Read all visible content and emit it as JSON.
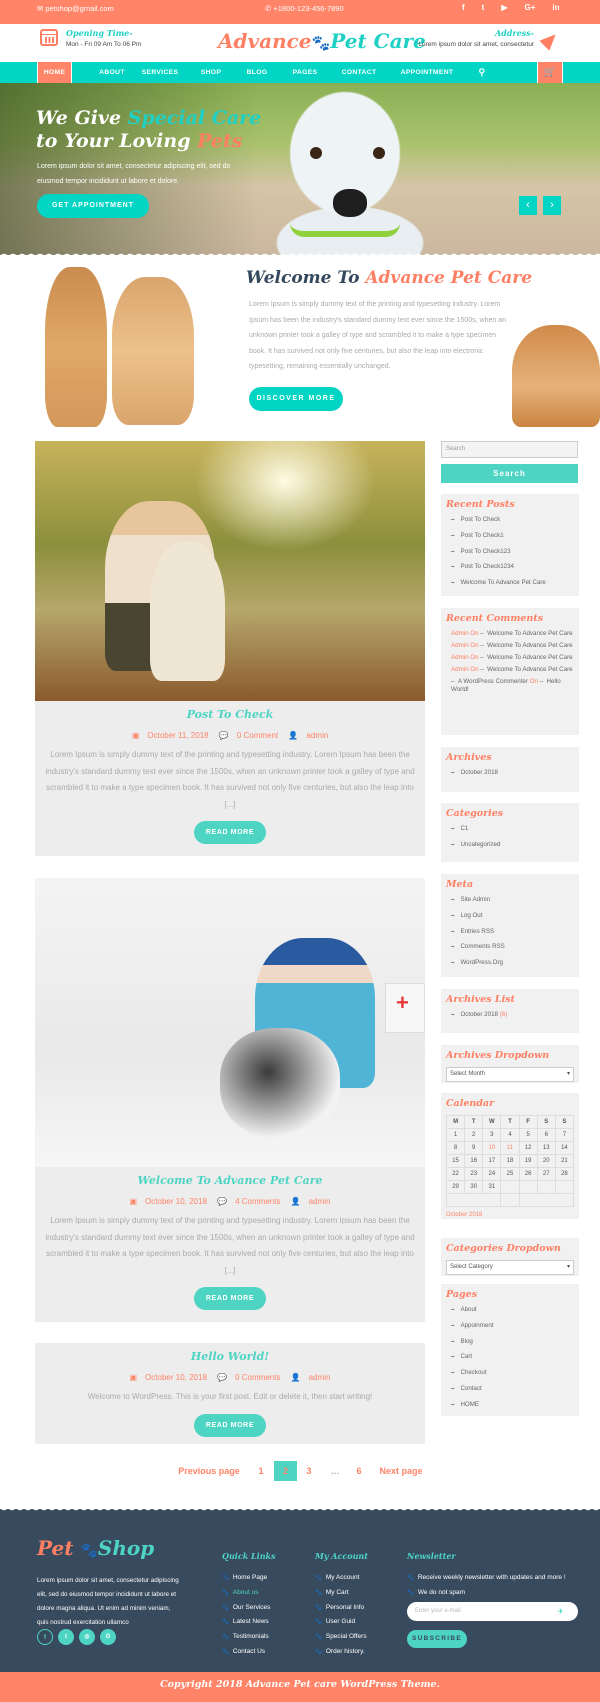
{
  "topbar": {
    "email": "petshop@gmail.com",
    "phone": "+1800-123-456-7890",
    "social": [
      "f",
      "t",
      "▶",
      "G+",
      "in"
    ],
    "social_names": [
      "facebook",
      "twitter",
      "youtube",
      "google-plus",
      "linkedin"
    ]
  },
  "header": {
    "opening_title": "Opening Time-",
    "opening_hours": "Mon - Fri 09 Am To 06 Pm",
    "logo_part1": "Advance",
    "logo_paw": "🐾",
    "logo_part2": "Pet Care",
    "address_title": "Address-",
    "address_text": "Lorem ipsum dolor sit amet, consectetur"
  },
  "nav": {
    "items": [
      "HOME",
      "ABOUT",
      "SERVICES",
      "SHOP",
      "BLOG",
      "PAGES",
      "CONTACT",
      "APPOINTMENT"
    ],
    "search_icon": "⚲",
    "cart_icon": "🛒"
  },
  "hero": {
    "line1_a": "We Give ",
    "line1_b": "Special Care",
    "line2_a": "to Your Loving ",
    "line2_b": "Pets",
    "text": "Lorem ipsum dolor sit amet, consectetur adipiscing elit, sed do eiusmod tempor incididunt ut labore et dolore.",
    "button": "GET APPOINTMENT",
    "prev": "‹",
    "next": "›"
  },
  "welcome": {
    "title_a": "Welcome To ",
    "title_b": "Advance Pet Care",
    "text": "Lorem Ipsum is simply dummy text of the printing and typesetting industry. Lorem Ipsum has been the industry's standard dummy text ever since the 1500s, when an unknown printer took a galley of type and scrambled it to make a type specimen book. It has survived not only five centuries, but also the leap into electronic typesetting, remaining essentially unchanged.",
    "button": "DISCOVER MORE"
  },
  "posts": [
    {
      "title": "Post To Check",
      "date": "October 11, 2018",
      "comments": "0 Comment",
      "author": "admin",
      "excerpt": "Lorem Ipsum is simply dummy text of the printing and typesetting industry. Lorem Ipsum has been the industry's standard dummy text ever since the 1500s, when an unknown printer took a galley of type and scrambled it to make a type specimen book. It has survived not only five centuries, but also the leap into [...]",
      "button": "READ MORE"
    },
    {
      "title": "Welcome To Advance Pet Care",
      "date": "October 10, 2018",
      "comments": "4 Comments",
      "author": "admin",
      "excerpt": "Lorem Ipsum is simply dummy text of the printing and typesetting industry. Lorem Ipsum has been the industry's standard dummy text ever since the 1500s, when an unknown printer took a galley of type and scrambled it to make a type specimen book. It has survived not only five centuries, but also the leap into [...]",
      "button": "READ MORE"
    },
    {
      "title": "Hello World!",
      "date": "October 10, 2018",
      "comments": "0 Comments",
      "author": "admin",
      "excerpt": "Welcome to WordPress. This is your first post. Edit or delete it, then start writing!",
      "button": "READ MORE"
    }
  ],
  "pagination": {
    "prev": "Previous page",
    "pages": [
      "1",
      "2",
      "3",
      "…",
      "6"
    ],
    "current": "2",
    "next": "Next page"
  },
  "sidebar": {
    "search_placeholder": "Search",
    "search_button": "Search",
    "recent_posts": {
      "title": "Recent Posts",
      "items": [
        "Post To Check",
        "Post To Check1",
        "Post To Check123",
        "Post To Check1234",
        "Welcome To Advance Pet Care"
      ]
    },
    "recent_comments": {
      "title": "Recent Comments",
      "items": [
        {
          "author": "Admin",
          "on": "On",
          "post": "Welcome To Advance Pet Care"
        },
        {
          "author": "Admin",
          "on": "On",
          "post": "Welcome To Advance Pet Care"
        },
        {
          "author": "Admin",
          "on": "On",
          "post": "Welcome To Advance Pet Care"
        },
        {
          "author": "Admin",
          "on": "On",
          "post": "Welcome To Advance Pet Care"
        },
        {
          "author": "A WordPress Commenter",
          "on": "On",
          "post": "Hello World!"
        }
      ]
    },
    "archives": {
      "title": "Archives",
      "items": [
        "October 2018"
      ]
    },
    "categories": {
      "title": "Categories",
      "items": [
        "C1",
        "Uncategorized"
      ]
    },
    "meta": {
      "title": "Meta",
      "items": [
        "Site Admin",
        "Log Out",
        "Entries RSS",
        "Comments RSS",
        "WordPress.Org"
      ]
    },
    "archives_list": {
      "title": "Archives List",
      "item": "October 2018",
      "count": "(6)"
    },
    "archives_dropdown": {
      "title": "Archives Dropdown",
      "value": "Select Month"
    },
    "calendar": {
      "title": "Calendar",
      "days": [
        "M",
        "T",
        "W",
        "T",
        "F",
        "S",
        "S"
      ],
      "weeks": [
        [
          "1",
          "2",
          "3",
          "4",
          "5",
          "6",
          "7"
        ],
        [
          "8",
          "9",
          "10",
          "11",
          "12",
          "13",
          "14"
        ],
        [
          "15",
          "16",
          "17",
          "18",
          "19",
          "20",
          "21"
        ],
        [
          "22",
          "23",
          "24",
          "25",
          "26",
          "27",
          "28"
        ],
        [
          "29",
          "30",
          "31",
          "",
          "",
          "",
          ""
        ]
      ],
      "linked_days": [
        "10",
        "11"
      ],
      "caption": "October 2018"
    },
    "categories_dropdown": {
      "title": "Categories Dropdown",
      "value": "Select Category"
    },
    "pages": {
      "title": "Pages",
      "items": [
        "About",
        "Appoinment",
        "Blog",
        "Cart",
        "Checkout",
        "Contact",
        "HOME"
      ]
    }
  },
  "footer": {
    "logo_a": "Pet",
    "logo_paw": "🐾",
    "logo_b": "Shop",
    "text": "Lorem ipsum dolor sit amet, consectetur adipiscing elit, sed do eiusmod tempor incididunt ut labore et dolore magna aliqua. Ut enim ad minim veniam, quis nostrud exercitation ullamco",
    "social": [
      "f",
      "t",
      "◎",
      "G"
    ],
    "quick_links": {
      "title": "Quick Links",
      "items": [
        "Home Page",
        "About us",
        "Our Services",
        "Latest News",
        "Testimonials",
        "Contact Us"
      ],
      "active": "About us"
    },
    "my_account": {
      "title": "My Account",
      "items": [
        "My Account",
        "My Cart",
        "Personal Info",
        "User Guid",
        "Special Offers",
        "Order history."
      ]
    },
    "newsletter": {
      "title": "Newsletter",
      "items": [
        "Receive weekly newsletter with updates and more !",
        "We do not spam"
      ],
      "placeholder": "Enter your e-mail",
      "button": "SUBSCRIBE"
    },
    "copyright": "Copyright 2018 Advance Pet care WordPress Theme."
  },
  "colors": {
    "accent_orange": "#ff8468",
    "accent_teal": "#02d5c4",
    "footer_bg": "#384b5e"
  }
}
